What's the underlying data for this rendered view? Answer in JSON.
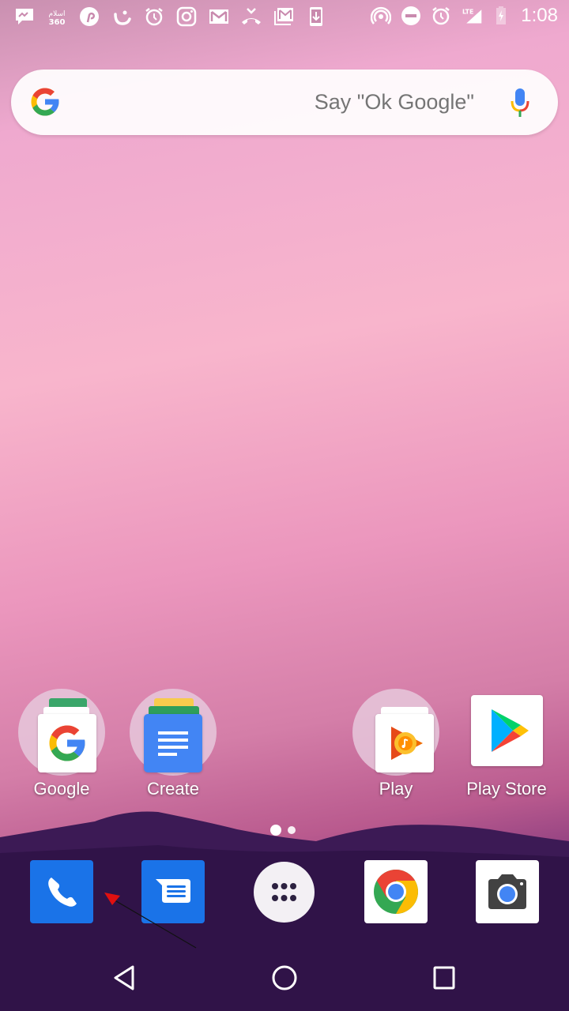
{
  "status_bar": {
    "time": "1:08",
    "network_label": "LTE",
    "left_icons": [
      "messenger-icon",
      "islam360-icon",
      "pinterest-icon",
      "smile-app-icon",
      "alarm-icon",
      "instagram-icon",
      "gmail-icon",
      "missed-call-icon",
      "gmail-multiple-icon",
      "download-icon"
    ],
    "right_icons": [
      "hotspot-icon",
      "do-not-disturb-icon",
      "alarm-icon",
      "lte-signal-icon",
      "battery-charging-icon"
    ],
    "islam360_text": "360"
  },
  "search": {
    "hint": "Say \"Ok Google\""
  },
  "home_apps": [
    {
      "label": "Google"
    },
    {
      "label": "Create"
    },
    {
      "label": "Play"
    },
    {
      "label": "Play Store"
    }
  ],
  "page_indicator": {
    "current": 1,
    "total": 2
  },
  "dock": [
    "Phone",
    "Messages",
    "All apps",
    "Chrome",
    "Camera"
  ],
  "colors": {
    "google_blue": "#4285F4",
    "google_red": "#EA4335",
    "google_yellow": "#FBBC05",
    "google_green": "#34A853",
    "dock_blue": "#1a73e8"
  }
}
